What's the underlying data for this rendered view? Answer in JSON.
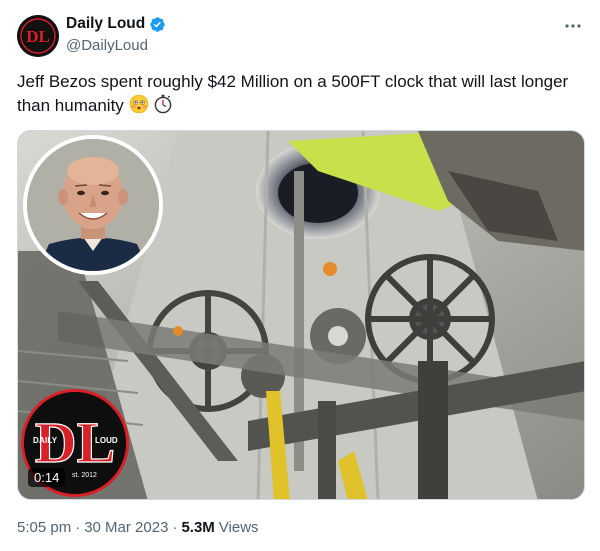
{
  "tweet": {
    "display_name": "Daily Loud",
    "handle": "@DailyLoud",
    "text": "Jeff Bezos spent roughly $42 Million on a 500FT clock that will last longer than humanity",
    "emojis": [
      "flushed-face",
      "stopwatch"
    ],
    "more_icon": "ellipsis-icon",
    "verified": true
  },
  "media": {
    "type": "video",
    "duration": "0:14",
    "logo": {
      "monogram": "DL",
      "left_text": "DAILY",
      "right_text": "LOUD",
      "est_text": "st. 2012"
    }
  },
  "meta": {
    "time": "5:05 pm",
    "separator": "·",
    "date": "30 Mar 2023",
    "views_count": "5.3M",
    "views_label": "Views"
  },
  "colors": {
    "text_primary": "#0f1419",
    "text_secondary": "#536471",
    "verified_blue": "#1d9bf0",
    "brand_red": "#d82028"
  }
}
